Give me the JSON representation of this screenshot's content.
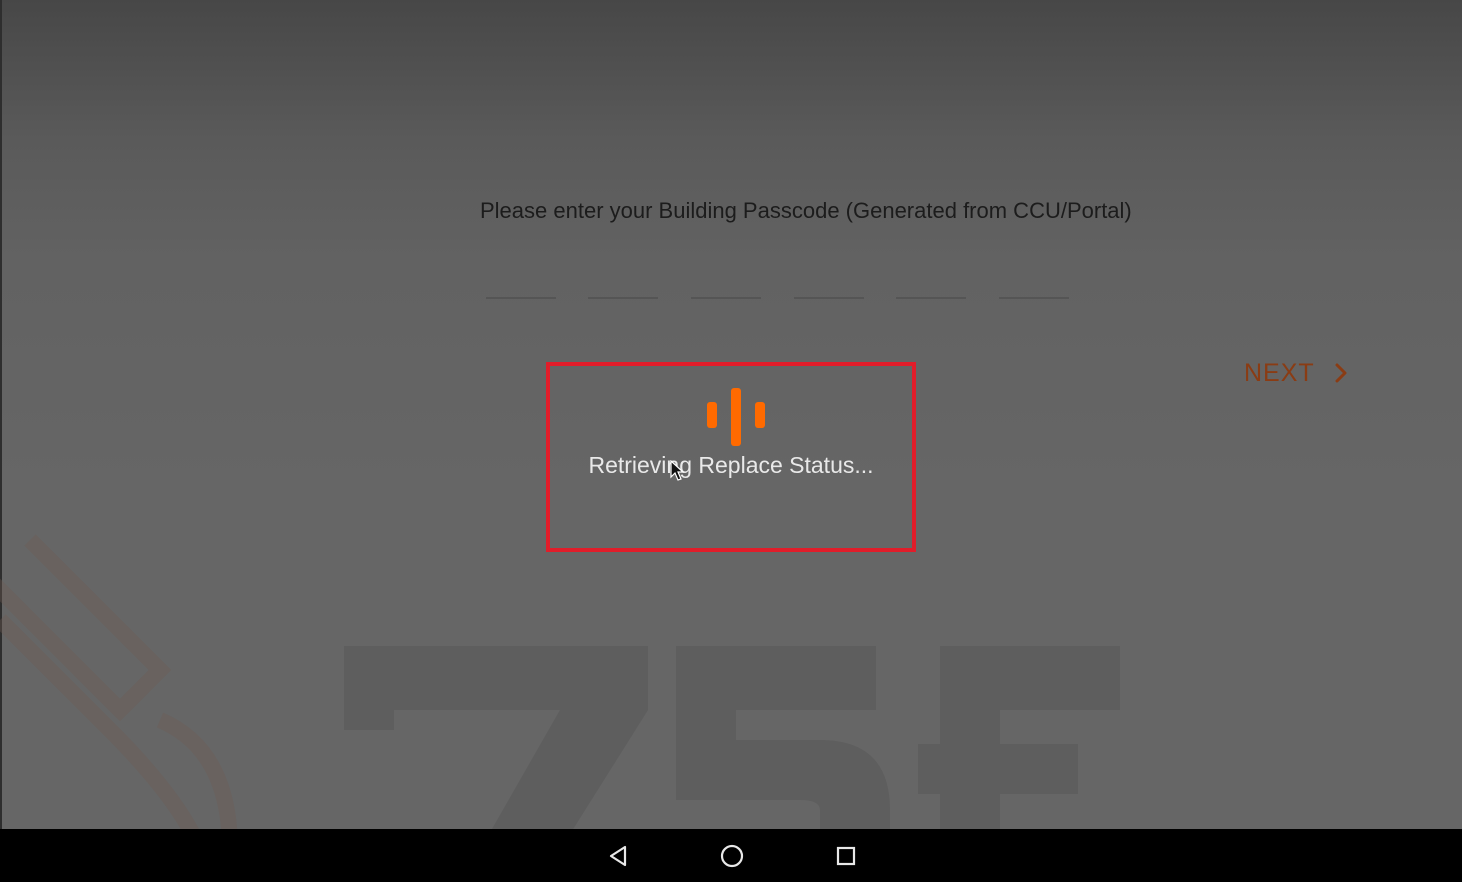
{
  "screen": {
    "prompt_text": "Please enter your Building Passcode (Generated from CCU/Portal)",
    "passcode_digits": [
      "",
      "",
      "",
      "",
      "",
      ""
    ],
    "next_label": "NEXT",
    "watermark_text": "75F"
  },
  "loading_dialog": {
    "message": "Retrieving Replace Status..."
  },
  "nav_bar": {
    "back_icon": "back-triangle-icon",
    "home_icon": "home-circle-icon",
    "recents_icon": "recents-square-icon"
  },
  "colors": {
    "accent_orange": "#ff6a00",
    "next_text": "#8a3c14",
    "highlight_border": "#e11d2a"
  }
}
